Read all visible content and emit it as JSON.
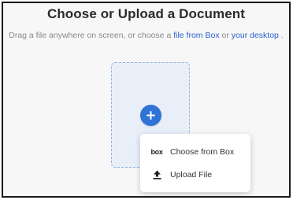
{
  "header": {
    "title": "Choose or Upload a Document",
    "subtitle_prefix": "Drag a file anywhere on screen, or choose a",
    "link_box": "file from Box",
    "subtitle_or": "or",
    "link_desktop": "your desktop",
    "subtitle_suffix": "."
  },
  "dropzone": {
    "add_icon": "plus-icon"
  },
  "menu": {
    "items": [
      {
        "icon": "box-logo-icon",
        "icon_text": "box",
        "label": "Choose from Box"
      },
      {
        "icon": "upload-icon",
        "label": "Upload File"
      }
    ]
  },
  "colors": {
    "accent": "#2f73d6",
    "link": "#2c61cf",
    "dropzone_bg": "#e9eff9",
    "dropzone_border": "#8db2e2",
    "background": "#f7f7f7"
  }
}
